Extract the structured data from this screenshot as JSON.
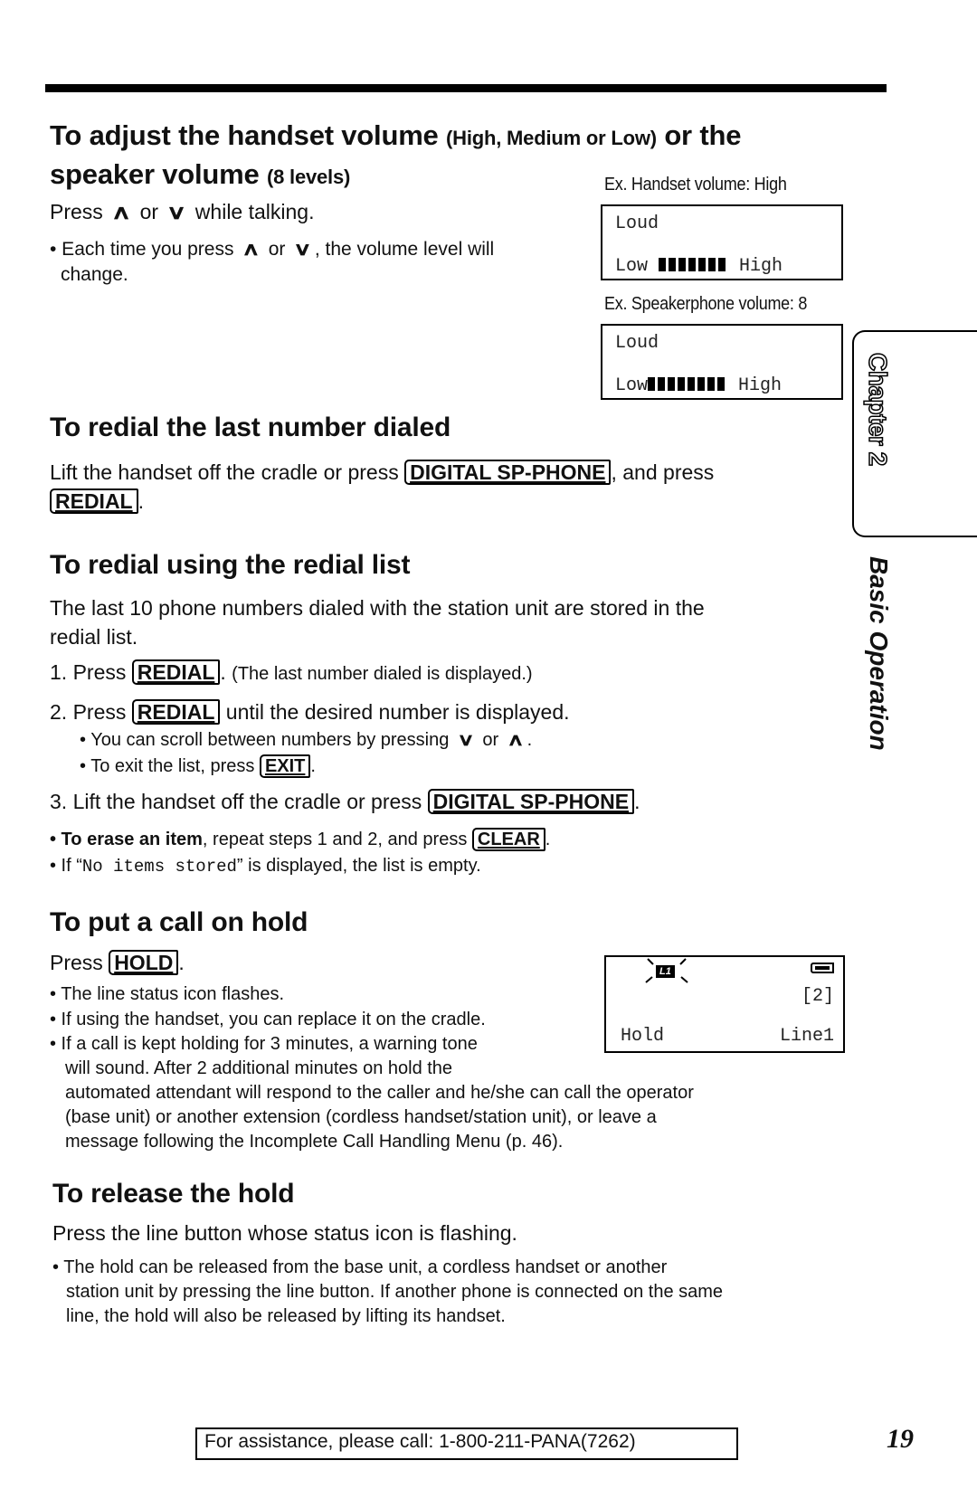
{
  "section_volume": {
    "title_main_1": "To adjust the handset volume ",
    "title_small_1": "(High, Medium or Low)",
    "title_main_2": " or the",
    "title_main_3": "speaker volume ",
    "title_small_2": "(8 levels)",
    "instruction_pre": "Press ",
    "up_arrow": "∧",
    "or_text": " or ",
    "down_arrow": "∨",
    "instruction_post": " while talking.",
    "bullet_pre": "• Each time you press ",
    "bullet_post": ", the volume level will",
    "bullet_cont": "change.",
    "handset_example": {
      "caption": "Ex. Handset volume: High",
      "line1": "Loud",
      "low_label": "Low",
      "high_label": "High",
      "level": 7,
      "max_level": 7
    },
    "speaker_example": {
      "caption": "Ex. Speakerphone volume: 8",
      "line1": "Loud",
      "low_label": "Low",
      "high_label": "High",
      "level": 8,
      "max_level": 8
    }
  },
  "section_redial_last": {
    "title": "To redial the last number dialed",
    "text_pre": "Lift the handset off the cradle or press ",
    "key1": "DIGITAL SP-PHONE",
    "text_mid": ", and press",
    "key2": "REDIAL",
    "text_end": "."
  },
  "section_redial_list": {
    "title": "To redial using the redial list",
    "intro_line1": "The last 10 phone numbers dialed with the station unit are stored in the",
    "intro_line2": "redial list.",
    "step1_pre": "1. Press ",
    "step1_key": "REDIAL",
    "step1_post": ". ",
    "step1_note": "(The last number dialed is displayed.)",
    "step2_pre": "2. Press ",
    "step2_key": "REDIAL",
    "step2_post": " until the desired number is displayed.",
    "step2_bullet1_pre": "• You can scroll between numbers by pressing ",
    "step2_bullet1_down": "∨",
    "step2_bullet1_or": " or ",
    "step2_bullet1_up": "∧",
    "step2_bullet1_post": ".",
    "step2_bullet2_pre": "• To exit the list, press ",
    "step2_bullet2_key": "EXIT",
    "step2_bullet2_post": ".",
    "step3_pre": "3. Lift the handset off the cradle or press ",
    "step3_key": "DIGITAL SP-PHONE",
    "step3_post": ".",
    "note1_bold": "• To erase an item",
    "note1_text": ", repeat steps 1 and 2, and press ",
    "note1_key": "CLEAR",
    "note1_post": ".",
    "note2_pre": "• If “",
    "note2_mono": "No items stored",
    "note2_post": "” is displayed, the list is empty."
  },
  "section_hold": {
    "title": "To put a call on hold",
    "text_pre": "Press ",
    "key": "HOLD",
    "text_post": ".",
    "bullet1": "• The line status icon flashes.",
    "bullet2": "• If using the handset, you can replace it on the cradle.",
    "bullet3_l1": "• If a call is kept holding for 3 minutes, a warning tone",
    "bullet3_l2": "will sound. After 2 additional minutes on hold the",
    "bullet3_l3": "automated attendant will respond to the caller and he/she can call the operator",
    "bullet3_l4": "(base unit) or another extension (cordless handset/station unit), or leave a",
    "bullet3_l5": "message following the Incomplete Call Handling Menu (p. 46).",
    "display": {
      "line_icon": "L1",
      "count": "[2]",
      "left": "Hold",
      "right": "Line1"
    }
  },
  "section_release": {
    "title": "To release the hold",
    "text": "Press the line button whose status icon is flashing.",
    "bullet_l1": "• The hold can be released from the base unit, a cordless handset or another",
    "bullet_l2": "station unit by pressing the line button. If another phone is connected on the same",
    "bullet_l3": "line, the hold will also be released by lifting its handset."
  },
  "side_tab": {
    "chapter": "Chapter 2",
    "section": "Basic Operation"
  },
  "footer": {
    "assistance": "For assistance, please call: 1-800-211-PANA(7262)",
    "page_number": "19"
  }
}
